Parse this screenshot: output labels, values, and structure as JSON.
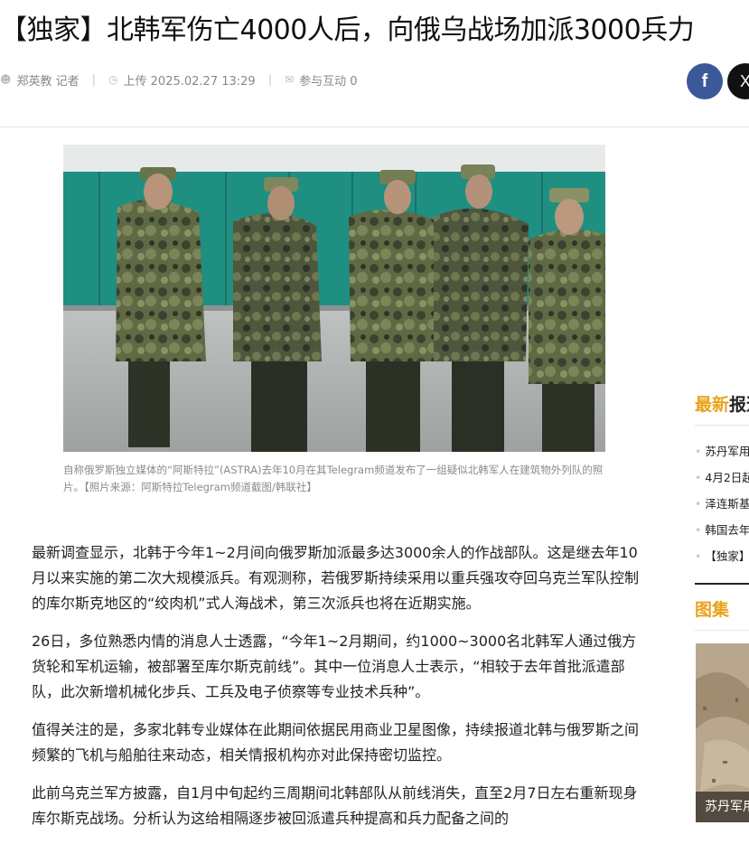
{
  "article": {
    "headline": "【独家】北韩军伤亡4000人后，向俄乌战场加派3000兵力",
    "author": "郑英教 记者",
    "upload": "上传 2025.02.27 13:29",
    "comments": "参与互动 0",
    "image_caption": "自称俄罗斯独立媒体的“阿斯特拉”(ASTRA)去年10月在其Telegram频道发布了一组疑似北韩军人在建筑物外列队的照片。【照片来源：阿斯特拉Telegram频道截图/韩联社】",
    "paragraphs": [
      "最新调查显示，北韩于今年1~2月间向俄罗斯加派最多达3000余人的作战部队。这是继去年10月以来实施的第二次大规模派兵。有观测称，若俄罗斯持续采用以重兵强攻夺回乌克兰军队控制的库尔斯克地区的“绞肉机”式人海战术，第三次派兵也将在近期实施。",
      "26日，多位熟悉内情的消息人士透露，“今年1~2月期间，约1000~3000名北韩军人通过俄方货轮和军机运输，被部署至库尔斯克前线”。其中一位消息人士表示，“相较于去年首批派遣部队，此次新增机械化步兵、工兵及电子侦察等专业技术兵种”。",
      "值得关注的是，多家北韩专业媒体在此期间依据民用商业卫星图像，持续报道北韩与俄罗斯之间频繁的飞机与船舶往来动态，相关情报机构亦对此保持密切监控。",
      "此前乌克兰军方披露，自1月中旬起约三周期间北韩部队从前线消失，直至2月7日左右重新现身库尔斯克战场。分析认为这给相隔逐步被回派遣兵种提高和兵力配备之间的"
    ]
  },
  "share": {
    "facebook": "f",
    "x": "X"
  },
  "sidebar": {
    "latest_accent": "最新",
    "latest_rest": "报道",
    "items": [
      "苏丹军用",
      "4月2日起",
      "泽连斯基",
      "韩国去年",
      "【独家】"
    ],
    "gallery_title": "图集",
    "gallery_caption": "苏丹军用"
  },
  "colors": {
    "accent": "#e8a41e",
    "facebook": "#3b5998"
  }
}
